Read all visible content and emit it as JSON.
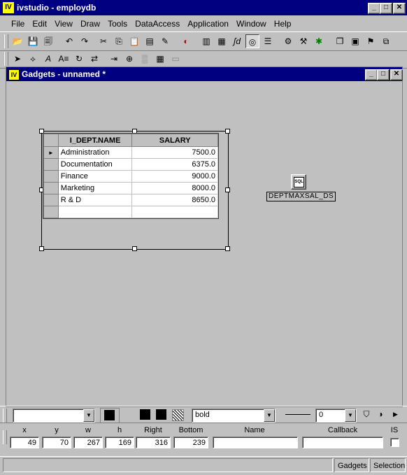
{
  "app": {
    "title": "ivstudio - employdb",
    "icon_text": "IV"
  },
  "menu": [
    "File",
    "Edit",
    "View",
    "Draw",
    "Tools",
    "DataAccess",
    "Application",
    "Window",
    "Help"
  ],
  "child_window": {
    "title": "Gadgets - unnamed *",
    "icon_text": "IV"
  },
  "grid": {
    "columns": [
      "I_DEPT.NAME",
      "SALARY"
    ],
    "rows": [
      {
        "name": "Administration",
        "salary": "7500.0"
      },
      {
        "name": "Documentation",
        "salary": "6375.0"
      },
      {
        "name": "Finance",
        "salary": "9000.0"
      },
      {
        "name": "Marketing",
        "salary": "8000.0"
      },
      {
        "name": "R & D",
        "salary": "8650.0"
      }
    ],
    "current_row_marker": "►"
  },
  "datasource": {
    "label": "DEPTMAXSAL_DS",
    "icon_text": "SQL"
  },
  "style_toolbar": {
    "font_combo_value": "",
    "weight_combo_value": "bold",
    "line_width_value": "0"
  },
  "geometry": {
    "labels": {
      "x": "x",
      "y": "y",
      "w": "w",
      "h": "h",
      "right": "Right",
      "bottom": "Bottom",
      "name": "Name",
      "callback": "Callback",
      "is": "IS"
    },
    "values": {
      "x": "49",
      "y": "70",
      "w": "267",
      "h": "169",
      "right": "316",
      "bottom": "239",
      "name": "",
      "callback": ""
    }
  },
  "status": {
    "pane1": "Gadgets",
    "pane2": "Selection"
  }
}
